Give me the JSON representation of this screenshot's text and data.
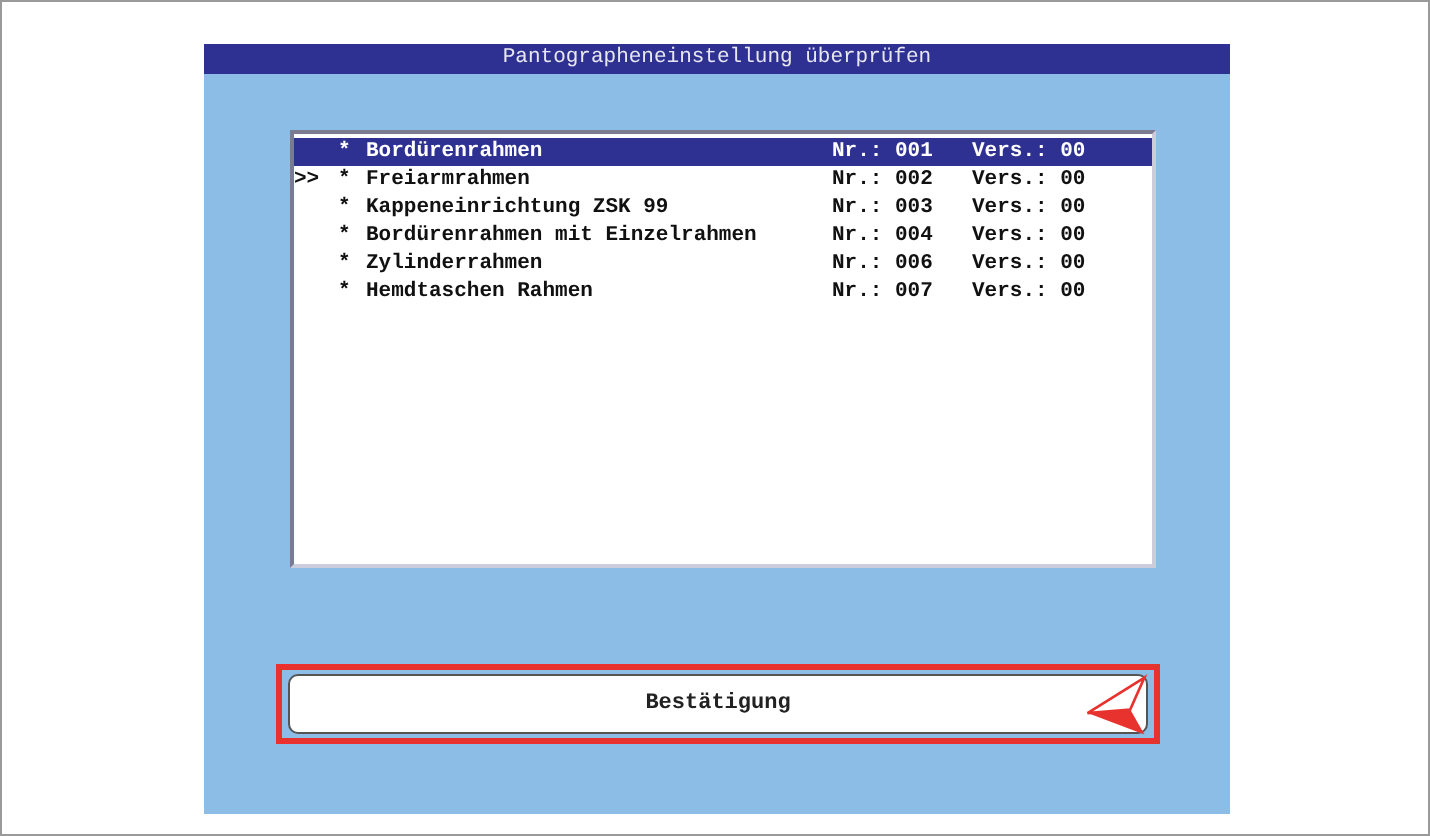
{
  "window": {
    "title": "Pantographeneinstellung überprüfen"
  },
  "list": {
    "items": [
      {
        "marker": "",
        "bullet": "*",
        "name": "Bordürenrahmen",
        "number": "Nr.: 001",
        "version": "Vers.: 00",
        "selected": true
      },
      {
        "marker": ">>",
        "bullet": "*",
        "name": "Freiarmrahmen",
        "number": "Nr.: 002",
        "version": "Vers.: 00",
        "selected": false
      },
      {
        "marker": "",
        "bullet": "*",
        "name": "Kappeneinrichtung ZSK 99",
        "number": "Nr.: 003",
        "version": "Vers.: 00",
        "selected": false
      },
      {
        "marker": "",
        "bullet": "*",
        "name": "Bordürenrahmen mit Einzelrahmen",
        "number": "Nr.: 004",
        "version": "Vers.: 00",
        "selected": false
      },
      {
        "marker": "",
        "bullet": "*",
        "name": "Zylinderrahmen",
        "number": "Nr.: 006",
        "version": "Vers.: 00",
        "selected": false
      },
      {
        "marker": "",
        "bullet": "*",
        "name": "Hemdtaschen Rahmen",
        "number": "Nr.: 007",
        "version": "Vers.: 00",
        "selected": false
      }
    ]
  },
  "confirm_button": {
    "label": "Bestätigung",
    "highlighted": true
  }
}
